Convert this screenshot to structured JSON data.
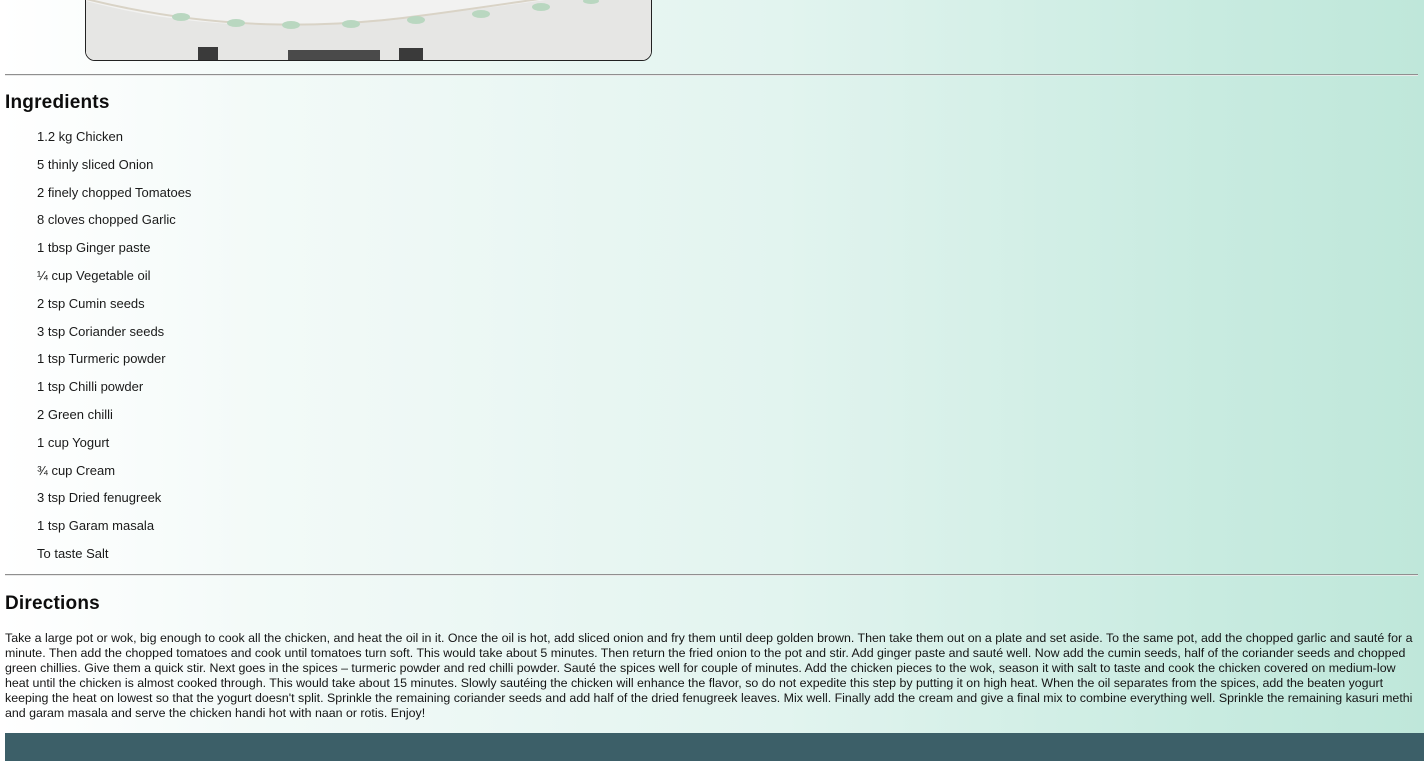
{
  "ingredients": {
    "title": "Ingredients",
    "items": [
      "1.2 kg Chicken",
      "5 thinly sliced Onion",
      "2 finely chopped Tomatoes",
      "8 cloves chopped Garlic",
      "1 tbsp Ginger paste",
      "¼ cup Vegetable oil",
      "2 tsp Cumin seeds",
      "3 tsp Coriander seeds",
      "1 tsp Turmeric powder",
      "1 tsp Chilli powder",
      "2 Green chilli",
      "1 cup Yogurt",
      "¾ cup Cream",
      "3 tsp Dried fenugreek",
      "1 tsp Garam masala",
      "To taste Salt"
    ]
  },
  "directions": {
    "title": "Directions",
    "text": "Take a large pot or wok, big enough to cook all the chicken, and heat the oil in it. Once the oil is hot, add sliced onion and fry them until deep golden brown. Then take them out on a plate and set aside. To the same pot, add the chopped garlic and sauté for a minute. Then add the chopped tomatoes and cook until tomatoes turn soft. This would take about 5 minutes. Then return the fried onion to the pot and stir. Add ginger paste and sauté well. Now add the cumin seeds, half of the coriander seeds and chopped green chillies. Give them a quick stir. Next goes in the spices – turmeric powder and red chilli powder. Sauté the spices well for couple of minutes. Add the chicken pieces to the wok, season it with salt to taste and cook the chicken covered on medium-low heat until the chicken is almost cooked through. This would take about 15 minutes. Slowly sautéing the chicken will enhance the flavor, so do not expedite this step by putting it on high heat. When the oil separates from the spices, add the beaten yogurt keeping the heat on lowest so that the yogurt doesn't split. Sprinkle the remaining coriander seeds and add half of the dried fenugreek leaves. Mix well. Finally add the cream and give a final mix to combine everything well. Sprinkle the remaining kasuri methi and garam masala and serve the chicken handi hot with naan or rotis. Enjoy!"
  },
  "colors": {
    "footer": "#3c5f68",
    "gradient_start": "#ffffff",
    "gradient_end": "#bfe7da"
  }
}
